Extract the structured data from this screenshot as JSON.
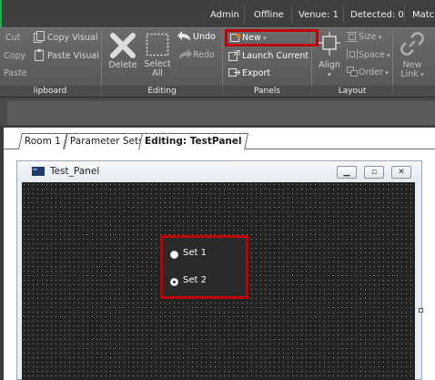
{
  "topbar": {
    "user": "Admin",
    "status": "Offline",
    "venue": "Venue: 1",
    "detected": "Detected: 0",
    "match": "Matc"
  },
  "ribbon": {
    "clipboard": {
      "cut": "Cut",
      "copy": "Copy",
      "paste": "Paste",
      "copy_visual": "Copy Visual",
      "paste_visual": "Paste Visual",
      "group": "lipboard"
    },
    "editing": {
      "delete": "Delete",
      "select_all_line1": "Select",
      "select_all_line2": "All",
      "undo": "Undo",
      "redo": "Redo",
      "group": "Editing"
    },
    "panels": {
      "new": "New",
      "launch_current": "Launch Current",
      "export": "Export",
      "group": "Panels"
    },
    "layout": {
      "align": "Align",
      "size": "Size",
      "space": "Space",
      "order": "Order",
      "group": "Layout"
    },
    "link": {
      "new_line1": "New",
      "new_line2": "Link"
    }
  },
  "tabs": [
    {
      "label": "Room 1"
    },
    {
      "label": "Parameter Sets"
    },
    {
      "label": "Editing: TestPanel"
    }
  ],
  "panel_window": {
    "title": "Test_Panel",
    "radios": [
      {
        "label": "Set 1",
        "selected": false
      },
      {
        "label": "Set 2",
        "selected": true
      }
    ]
  },
  "colors": {
    "highlight": "#c00000",
    "ribbon": "#5f5f5f",
    "canvas": "#232323"
  }
}
